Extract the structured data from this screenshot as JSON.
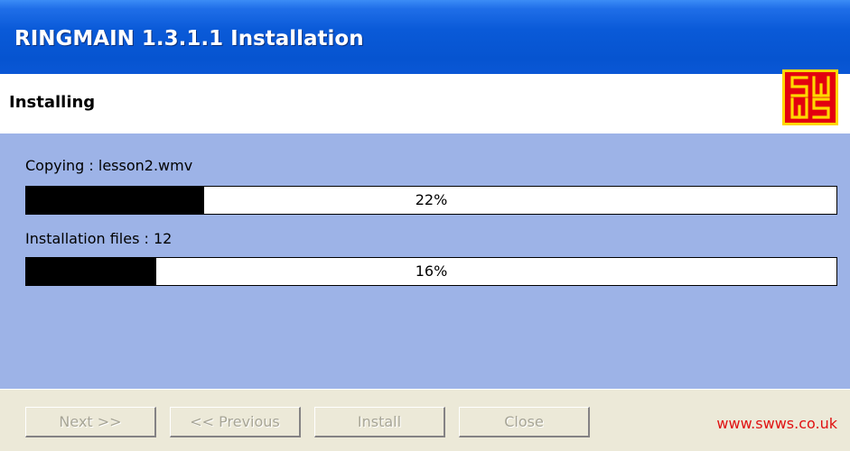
{
  "window": {
    "title": "RINGMAIN 1.3.1.1 Installation"
  },
  "header": {
    "title": "Installing",
    "logo_text": "SW WS"
  },
  "progress": [
    {
      "label": "Copying : lesson2.wmv",
      "percent": 22,
      "percent_text": "22%"
    },
    {
      "label": "Installation files : 12",
      "percent": 16,
      "percent_text": "16%"
    }
  ],
  "buttons": {
    "next": "Next >>",
    "previous": "<< Previous",
    "install": "Install",
    "close": "Close"
  },
  "footer": {
    "url": "www.swws.co.uk"
  },
  "colors": {
    "progress_fill": "#000000",
    "content_bg": "#9db3e7",
    "url": "#e01010",
    "logo_red": "#e3000f",
    "logo_yellow": "#ffd800"
  }
}
